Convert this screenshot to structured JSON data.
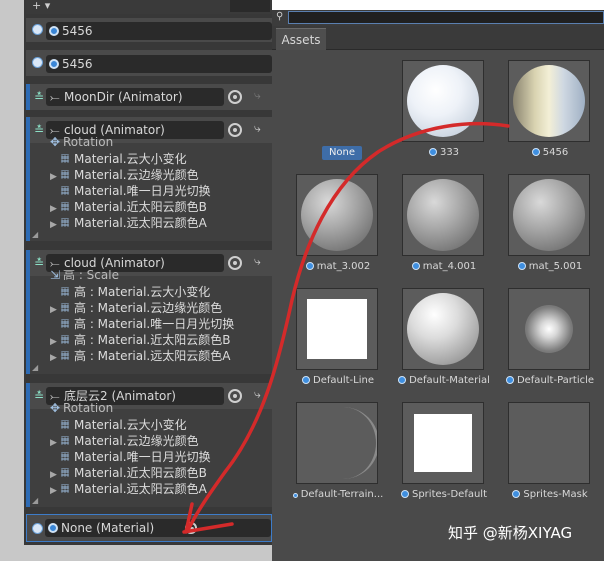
{
  "left_panel": {
    "top_rows": [
      {
        "label": "5456"
      },
      {
        "label": "5456"
      }
    ],
    "tracks": [
      {
        "label": "MoonDir (Animator)",
        "lines": []
      },
      {
        "label": "cloud (Animator)",
        "lines": [
          {
            "text": "Rotation",
            "expand": false,
            "partial": true
          },
          {
            "text": "Material.云大小变化",
            "expand": false
          },
          {
            "text": "Material.云边缘光颜色",
            "expand": true
          },
          {
            "text": "Material.唯一日月光切换",
            "expand": false
          },
          {
            "text": "Material.近太阳云颜色B",
            "expand": true
          },
          {
            "text": "Material.远太阳云颜色A",
            "expand": true
          }
        ]
      },
      {
        "label": "cloud (Animator)",
        "lines": [
          {
            "text": "高 : Scale",
            "expand": false,
            "partial": true
          },
          {
            "text": "高 : Material.云大小变化",
            "expand": false
          },
          {
            "text": "高 : Material.云边缘光颜色",
            "expand": true
          },
          {
            "text": "高 : Material.唯一日月光切换",
            "expand": false
          },
          {
            "text": "高 : Material.近太阳云颜色B",
            "expand": true
          },
          {
            "text": "高 : Material.远太阳云颜色A",
            "expand": true
          }
        ]
      },
      {
        "label": "底层云2 (Animator)",
        "lines": [
          {
            "text": "Rotation",
            "expand": false,
            "partial": true
          },
          {
            "text": "Material.云大小变化",
            "expand": false
          },
          {
            "text": "Material.云边缘光颜色",
            "expand": true
          },
          {
            "text": "Material.唯一日月光切换",
            "expand": false
          },
          {
            "text": "Material.近太阳云颜色B",
            "expand": true
          },
          {
            "text": "Material.远太阳云颜色A",
            "expand": true
          }
        ]
      }
    ],
    "bottom_row": {
      "label": "None (Material)"
    }
  },
  "picker": {
    "tab": "Assets",
    "none_label": "None",
    "assets": [
      {
        "name": "",
        "kind": "none"
      },
      {
        "name": "333",
        "kind": "sphere-white"
      },
      {
        "name": "5456",
        "kind": "sphere-gold"
      },
      {
        "name": "mat_3.002",
        "kind": "sphere-gray"
      },
      {
        "name": "mat_4.001",
        "kind": "sphere-gray"
      },
      {
        "name": "mat_5.001",
        "kind": "sphere-gray"
      },
      {
        "name": "Default-Line",
        "kind": "white-square"
      },
      {
        "name": "Default-Material",
        "kind": "sphere-light"
      },
      {
        "name": "Default-Particle",
        "kind": "particle"
      },
      {
        "name": "Default-Terrain...",
        "kind": "terrain"
      },
      {
        "name": "Sprites-Default",
        "kind": "white-square-small"
      },
      {
        "name": "Sprites-Mask",
        "kind": "mask"
      }
    ]
  },
  "watermark": "知乎 @新杨XIYAG",
  "annotation_color": "#d42a2a"
}
